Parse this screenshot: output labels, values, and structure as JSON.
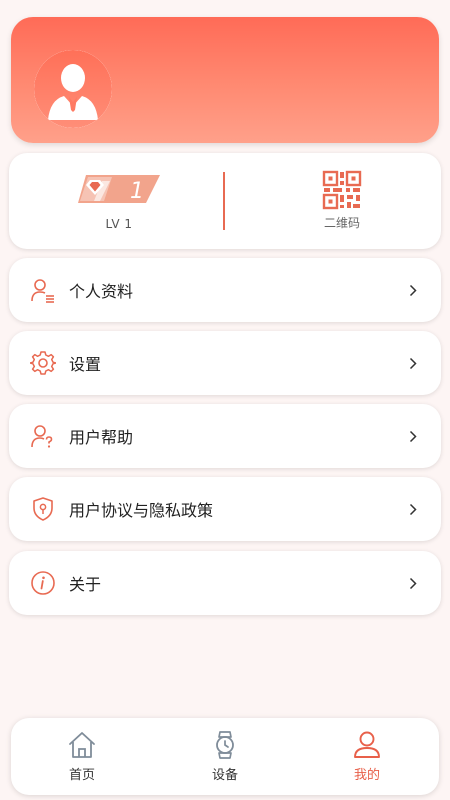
{
  "profile": {
    "avatar_icon": "user-avatar-icon"
  },
  "level": {
    "badge_number": "1",
    "label": "LV 1",
    "icon": "diamond-badge-icon"
  },
  "qr": {
    "label": "二维码",
    "icon": "qr-code-icon"
  },
  "menu": [
    {
      "label": "个人资料",
      "icon": "profile-list-icon"
    },
    {
      "label": "设置",
      "icon": "gear-icon"
    },
    {
      "label": "用户帮助",
      "icon": "user-help-icon"
    },
    {
      "label": "用户协议与隐私政策",
      "icon": "shield-lock-icon"
    },
    {
      "label": "关于",
      "icon": "info-icon"
    }
  ],
  "tabs": [
    {
      "label": "首页",
      "icon": "home-icon",
      "active": false
    },
    {
      "label": "设备",
      "icon": "watch-icon",
      "active": false
    },
    {
      "label": "我的",
      "icon": "person-icon",
      "active": true
    }
  ],
  "colors": {
    "accent": "#e8604a",
    "header_gradient_top": "#ff6b57",
    "header_gradient_bottom": "#ffa08a",
    "background": "#fdf5f4",
    "tab_inactive_icon": "#7f8c99"
  }
}
